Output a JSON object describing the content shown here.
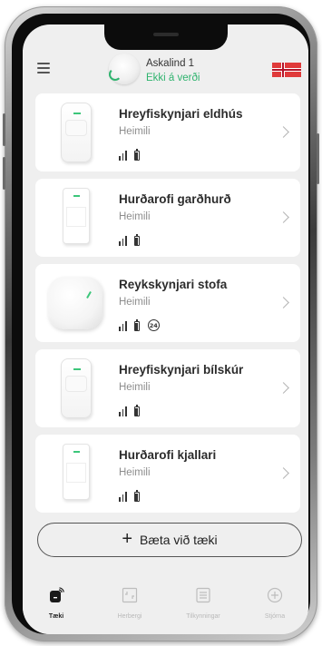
{
  "header": {
    "hub_name": "Askalind 1",
    "hub_status": "Ekki á verði",
    "menu_icon": "hamburger-menu-icon",
    "flag_icon": "icelandic-flag-icon"
  },
  "devices": [
    {
      "name": "Hreyfiskynjari eldhús",
      "room": "Heimili",
      "type": "motion",
      "has_24h": false
    },
    {
      "name": "Hurðarofi garðhurð",
      "room": "Heimili",
      "type": "door",
      "has_24h": false
    },
    {
      "name": "Reykskynjari stofa",
      "room": "Heimili",
      "type": "smoke",
      "has_24h": true,
      "badge_24": "24"
    },
    {
      "name": "Hreyfiskynjari bílskúr",
      "room": "Heimili",
      "type": "motion",
      "has_24h": false
    },
    {
      "name": "Hurðarofi kjallari",
      "room": "Heimili",
      "type": "door",
      "has_24h": false
    }
  ],
  "add_button": {
    "label": "Bæta við tæki",
    "icon": "plus-icon"
  },
  "tabs": [
    {
      "label": "Tæki",
      "icon": "device-icon",
      "active": true
    },
    {
      "label": "Herbergi",
      "icon": "room-icon",
      "active": false
    },
    {
      "label": "Tilkynningar",
      "icon": "notifications-icon",
      "active": false
    },
    {
      "label": "Stjórna",
      "icon": "control-icon",
      "active": false
    }
  ],
  "colors": {
    "accent_green": "#2fb36e",
    "background": "#efefef",
    "card": "#ffffff"
  }
}
